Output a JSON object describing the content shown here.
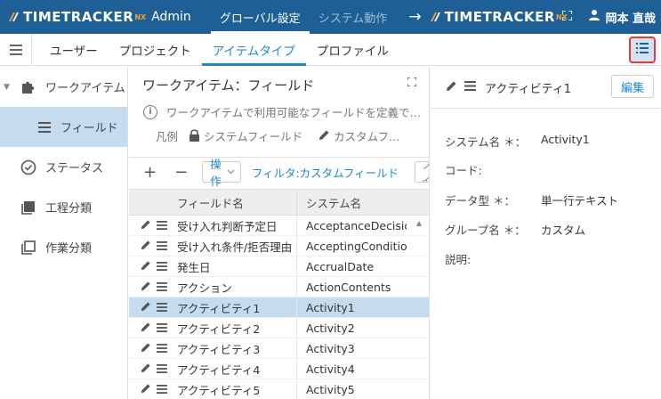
{
  "header": {
    "logo_text": "TIMETRACKER",
    "logo_suffix": "NX",
    "logo_admin": "Admin",
    "tabs": [
      {
        "label": "グローバル設定",
        "active": true
      },
      {
        "label": "システム動作",
        "active": false
      }
    ],
    "link_logo_text": "TIMETRACKER",
    "link_logo_suffix": "NX",
    "user_name": "岡本 直哉"
  },
  "secondary_tabs": [
    {
      "label": "ユーザー",
      "active": false
    },
    {
      "label": "プロジェクト",
      "active": false
    },
    {
      "label": "アイテムタイプ",
      "active": true
    },
    {
      "label": "プロファイル",
      "active": false
    }
  ],
  "sidebar": {
    "items": [
      {
        "label": "ワークアイテム",
        "icon": "puzzle-icon"
      },
      {
        "label": "フィールド",
        "icon": "list-icon",
        "selected": true
      },
      {
        "label": "ステータス",
        "icon": "check-circle-icon"
      },
      {
        "label": "工程分類",
        "icon": "stack-icon"
      },
      {
        "label": "作業分類",
        "icon": "copy-icon"
      }
    ]
  },
  "middle": {
    "title": "ワークアイテム：フィールド",
    "description": "ワークアイテムで利用可能なフィールドを定義で…",
    "legend_label": "凡例",
    "legend_system": "システムフィールド",
    "legend_custom": "カスタムフ…",
    "toolbar": {
      "add": "+",
      "remove": "−",
      "operations": "操作",
      "filter": "フィルタ:カスタムフィールド",
      "filter_box": "フィ"
    },
    "columns": [
      "フィールド名",
      "システム名"
    ],
    "rows": [
      {
        "name": "受け入れ判断予定日",
        "system": "AcceptanceDecisionD"
      },
      {
        "name": "受け入れ条件/拒否理由",
        "system": "AcceptingConditions"
      },
      {
        "name": "発生日",
        "system": "AccrualDate"
      },
      {
        "name": "アクション",
        "system": "ActionContents"
      },
      {
        "name": "アクティビティ1",
        "system": "Activity1",
        "selected": true
      },
      {
        "name": "アクティビティ2",
        "system": "Activity2"
      },
      {
        "name": "アクティビティ3",
        "system": "Activity3"
      },
      {
        "name": "アクティビティ4",
        "system": "Activity4"
      },
      {
        "name": "アクティビティ5",
        "system": "Activity5"
      }
    ]
  },
  "detail": {
    "title": "アクティビティ1",
    "edit_label": "編集",
    "props": [
      {
        "key": "システム名 ＊：",
        "value": "Activity1"
      },
      {
        "key": "コード:",
        "value": ""
      },
      {
        "key": "データ型 ＊：",
        "value": "単一行テキスト"
      },
      {
        "key": "グループ名 ＊：",
        "value": "カスタム"
      },
      {
        "key": "説明:",
        "value": ""
      }
    ]
  },
  "colors": {
    "header_bg": "#1e5f95",
    "accent": "#1e88c8",
    "selected_bg": "#c5dcef",
    "highlight_border": "#e53935",
    "logo_nx": "#f0a030"
  }
}
